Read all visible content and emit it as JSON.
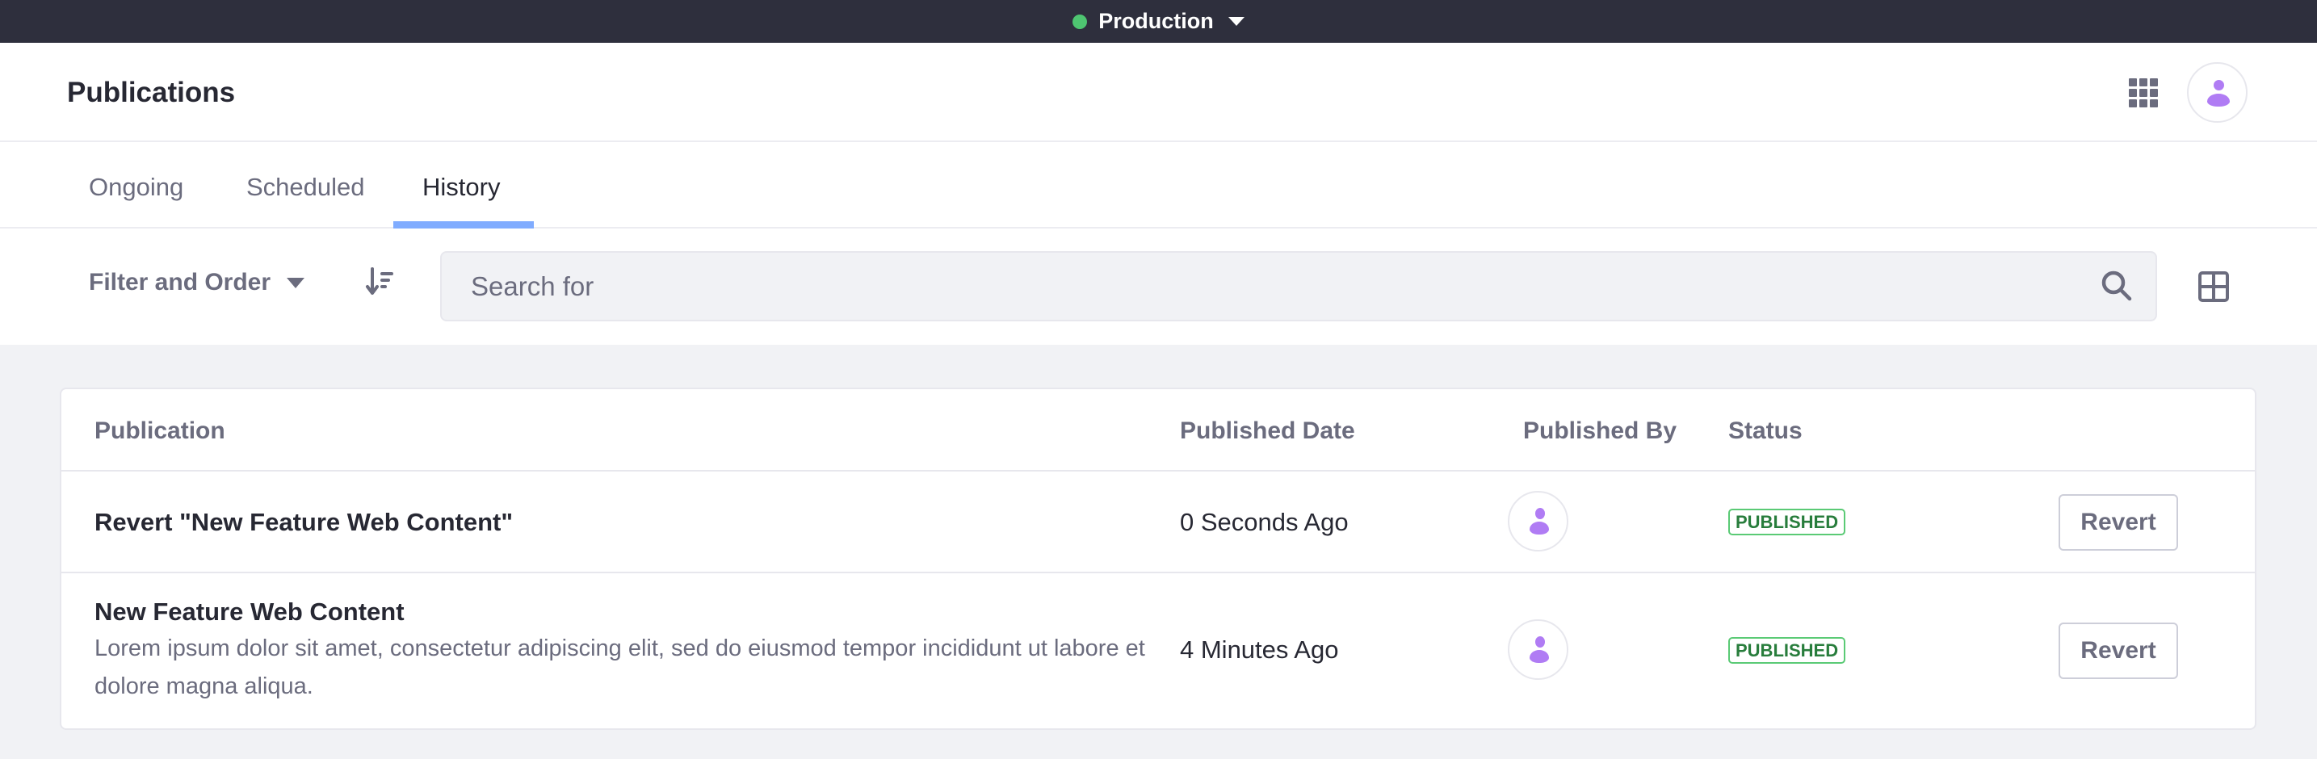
{
  "topbar": {
    "environment_label": "Production",
    "environment_status_color": "#4ec571"
  },
  "header": {
    "title": "Publications",
    "apps_icon": "apps-grid-icon",
    "avatar_icon": "user-icon",
    "accent_color": "#b07cf4"
  },
  "tabs": [
    {
      "label": "Ongoing",
      "active": false
    },
    {
      "label": "Scheduled",
      "active": false
    },
    {
      "label": "History",
      "active": true
    }
  ],
  "toolbar": {
    "filter_label": "Filter and Order",
    "sort_icon": "sort-icon",
    "search_placeholder": "Search for",
    "search_value": "",
    "search_icon": "search-icon",
    "view_icon": "table-view-icon"
  },
  "table": {
    "columns": [
      "Publication",
      "Published Date",
      "Published By",
      "Status",
      ""
    ],
    "rows": [
      {
        "title": "Revert \"New Feature Web Content\"",
        "description": "",
        "published_date": "0 Seconds Ago",
        "published_by_icon": "user-icon",
        "status": "PUBLISHED",
        "action": "Revert"
      },
      {
        "title": "New Feature Web Content",
        "description": "Lorem ipsum dolor sit amet, consectetur adipiscing elit, sed do eiusmod tempor incididunt ut labore et dolore magna aliqua.",
        "published_date": "4 Minutes Ago",
        "published_by_icon": "user-icon",
        "status": "PUBLISHED",
        "action": "Revert"
      }
    ],
    "status_color": "#287d3c"
  }
}
